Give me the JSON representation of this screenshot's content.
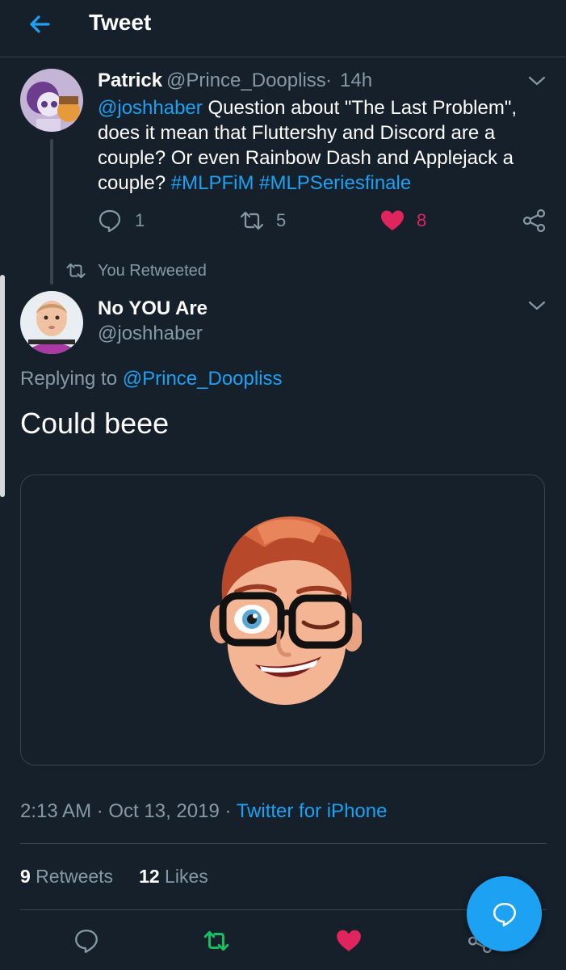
{
  "header": {
    "title": "Tweet",
    "back_icon": "arrow-left-icon"
  },
  "parent_tweet": {
    "name": "Patrick",
    "handle": "@Prince_Doopliss",
    "separator": "·",
    "time": "14h",
    "mention": "@joshhaber",
    "text": " Question about \"The Last Problem\", does it mean that Fluttershy and Discord are a couple? Or even Rainbow Dash and Applejack a couple? ",
    "hashtag1": "#MLPFiM",
    "hashtag2": "#MLPSeriesfinale",
    "reply_count": "1",
    "retweet_count": "5",
    "like_count": "8",
    "liked": true
  },
  "retweet_note": {
    "text": "You Retweeted"
  },
  "main_tweet": {
    "name": "No YOU Are",
    "handle": "@joshhaber",
    "replying_prefix": "Replying to ",
    "replying_to": "@Prince_Doopliss",
    "text": "Could beee",
    "time": "2:13 AM · Oct 13, 2019 · ",
    "source": "Twitter for iPhone",
    "retweets_count": "9",
    "retweets_label": " Retweets",
    "likes_count": "12",
    "likes_label": " Likes",
    "retweeted": true,
    "liked": true
  },
  "icons": {
    "reply": "reply-icon",
    "retweet": "retweet-icon",
    "like": "heart-icon",
    "share": "share-icon",
    "compose": "compose-icon"
  },
  "colors": {
    "background": "#15202b",
    "accent": "#1da1f2",
    "like": "#e0245e",
    "retweet": "#17bf63",
    "secondary_text": "#8899a6",
    "divider": "#38444d"
  }
}
